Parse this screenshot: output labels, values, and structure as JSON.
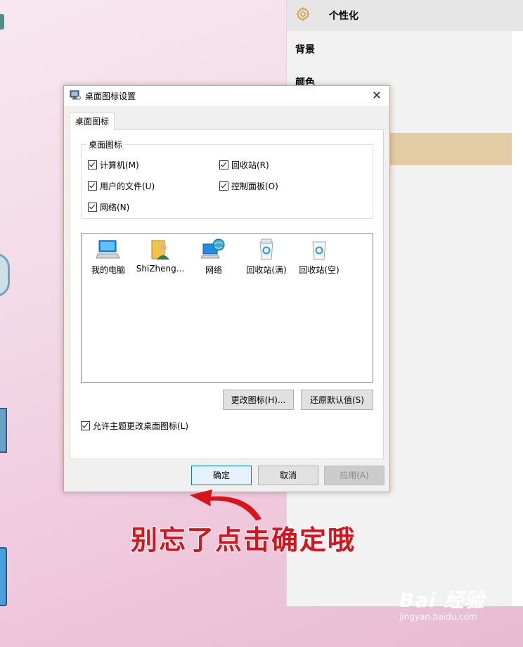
{
  "settings": {
    "title": "个性化",
    "items": [
      {
        "label": "背景"
      },
      {
        "label": "颜色"
      }
    ],
    "accent_color": "#e3cba3"
  },
  "dialog": {
    "title": "桌面图标设置",
    "close_glyph": "✕",
    "tab_label": "桌面图标",
    "group_label": "桌面图标",
    "checkboxes": [
      {
        "label": "计算机(M)",
        "checked": true
      },
      {
        "label": "回收站(R)",
        "checked": true
      },
      {
        "label": "用户的文件(U)",
        "checked": true
      },
      {
        "label": "控制面板(O)",
        "checked": true
      },
      {
        "label": "网络(N)",
        "checked": true
      }
    ],
    "icons": [
      {
        "label": "我的电脑",
        "icon": "computer-icon"
      },
      {
        "label": "ShiZheng...",
        "icon": "user-folder-icon"
      },
      {
        "label": "网络",
        "icon": "network-icon"
      },
      {
        "label": "回收站(满)",
        "icon": "recycle-bin-full-icon"
      },
      {
        "label": "回收站(空)",
        "icon": "recycle-bin-empty-icon"
      }
    ],
    "change_icon_label": "更改图标(H)...",
    "restore_default_label": "还原默认值(S)",
    "allow_theme": {
      "label": "允许主题更改桌面图标(L)",
      "checked": true
    },
    "ok_label": "确定",
    "cancel_label": "取消",
    "apply_label": "应用(A)",
    "apply_enabled": false
  },
  "annotation": {
    "text": "别忘了点击确定哦",
    "color": "#d9131b"
  },
  "watermark": {
    "main": "Bai 经验",
    "sub": "jingyan.baidu.com"
  }
}
